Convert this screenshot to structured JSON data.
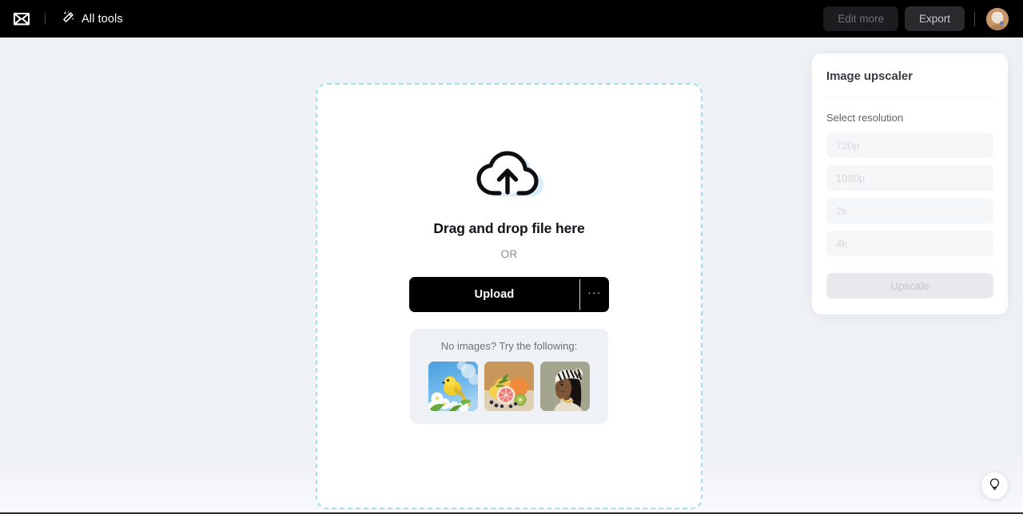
{
  "topbar": {
    "logo_icon": "capcut-logo-icon",
    "all_tools": {
      "icon": "magic-wand-icon",
      "label": "All tools"
    },
    "edit_more_label": "Edit more",
    "export_label": "Export",
    "avatar_icon": "user-avatar"
  },
  "dropzone": {
    "upload_cloud_icon": "cloud-upload-icon",
    "title": "Drag and drop file here",
    "or_text": "OR",
    "upload_label": "Upload",
    "more_label": "···",
    "samples": {
      "label": "No images? Try the following:",
      "thumbnails": [
        {
          "name": "yellow-bird-blossoms",
          "alt": "Yellow bird perched among white blossoms against blue sky"
        },
        {
          "name": "citrus-fruit-still-life",
          "alt": "Halved grapefruit with oranges, lemons, kiwi and blueberries"
        },
        {
          "name": "woman-headwrap-portrait",
          "alt": "Profile portrait of woman wearing patterned headwrap and gold necklace"
        }
      ]
    }
  },
  "panel": {
    "title": "Image upscaler",
    "section_label": "Select resolution",
    "resolutions": [
      {
        "label": "720p"
      },
      {
        "label": "1080p"
      },
      {
        "label": "2k"
      },
      {
        "label": "4k"
      }
    ],
    "upscale_label": "Upscale"
  },
  "help": {
    "icon": "lightbulb-icon"
  },
  "colors": {
    "page_background": "#eef1f5",
    "topbar_background": "#000000",
    "dashed_border": "#a8dcf0",
    "upload_button": "#000000",
    "panel_background": "#ffffff"
  }
}
